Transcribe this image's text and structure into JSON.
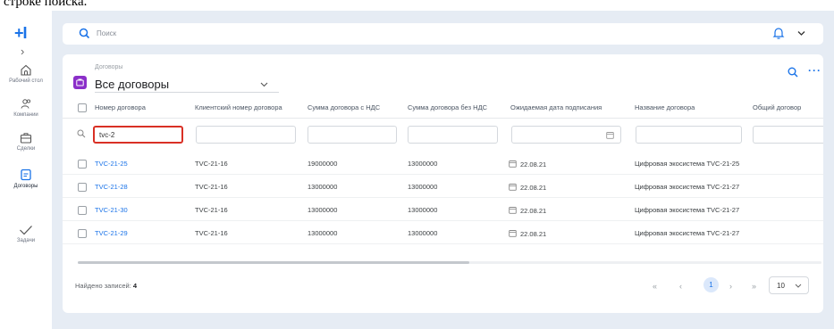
{
  "top_caption": "строке поиска.",
  "sidebar": {
    "logo": "+I",
    "collapse_glyph": "›",
    "items": [
      {
        "label": "Рабочий стол",
        "icon": "home-icon"
      },
      {
        "label": "Компании",
        "icon": "users-icon"
      },
      {
        "label": "Сделки",
        "icon": "briefcase-icon"
      },
      {
        "label": "Договоры",
        "icon": "document-icon",
        "active": true
      },
      {
        "label": "Задачи",
        "icon": "checkmark-icon"
      }
    ]
  },
  "search": {
    "placeholder": "Поиск"
  },
  "card": {
    "subtitle": "Договоры",
    "view_name": "Все договоры",
    "more_glyph": "···"
  },
  "table": {
    "columns": [
      "Номер договора",
      "Клиентский номер договора",
      "Сумма договора с НДС",
      "Сумма договора без НДС",
      "Ожидаемая дата подписания",
      "Название договора",
      "Общий договор"
    ],
    "filter_value": "tvc-2",
    "rows": [
      {
        "number": "TVC-21-25",
        "client_number": "TVC-21-16",
        "sum_vat": "19000000",
        "sum_novat": "13000000",
        "date": "22.08.21",
        "name": "Цифровая экосистема TVC-21-25"
      },
      {
        "number": "TVC-21-28",
        "client_number": "TVC-21-16",
        "sum_vat": "13000000",
        "sum_novat": "13000000",
        "date": "22.08.21",
        "name": "Цифровая экосистема TVC-21-27"
      },
      {
        "number": "TVC-21-30",
        "client_number": "TVC-21-16",
        "sum_vat": "13000000",
        "sum_novat": "13000000",
        "date": "22.08.21",
        "name": "Цифровая экосистема TVC-21-27"
      },
      {
        "number": "TVC-21-29",
        "client_number": "TVC-21-16",
        "sum_vat": "13000000",
        "sum_novat": "13000000",
        "date": "22.08.21",
        "name": "Цифровая экосистема TVC-21-27"
      }
    ]
  },
  "footer": {
    "found_label": "Найдено записей:",
    "found_count": "4",
    "first": "«",
    "prev": "‹",
    "page": "1",
    "next": "›",
    "last": "»",
    "page_size": "10"
  },
  "colors": {
    "accent": "#1a73e8",
    "badge": "#8b2fc9",
    "highlight": "#d93025"
  }
}
